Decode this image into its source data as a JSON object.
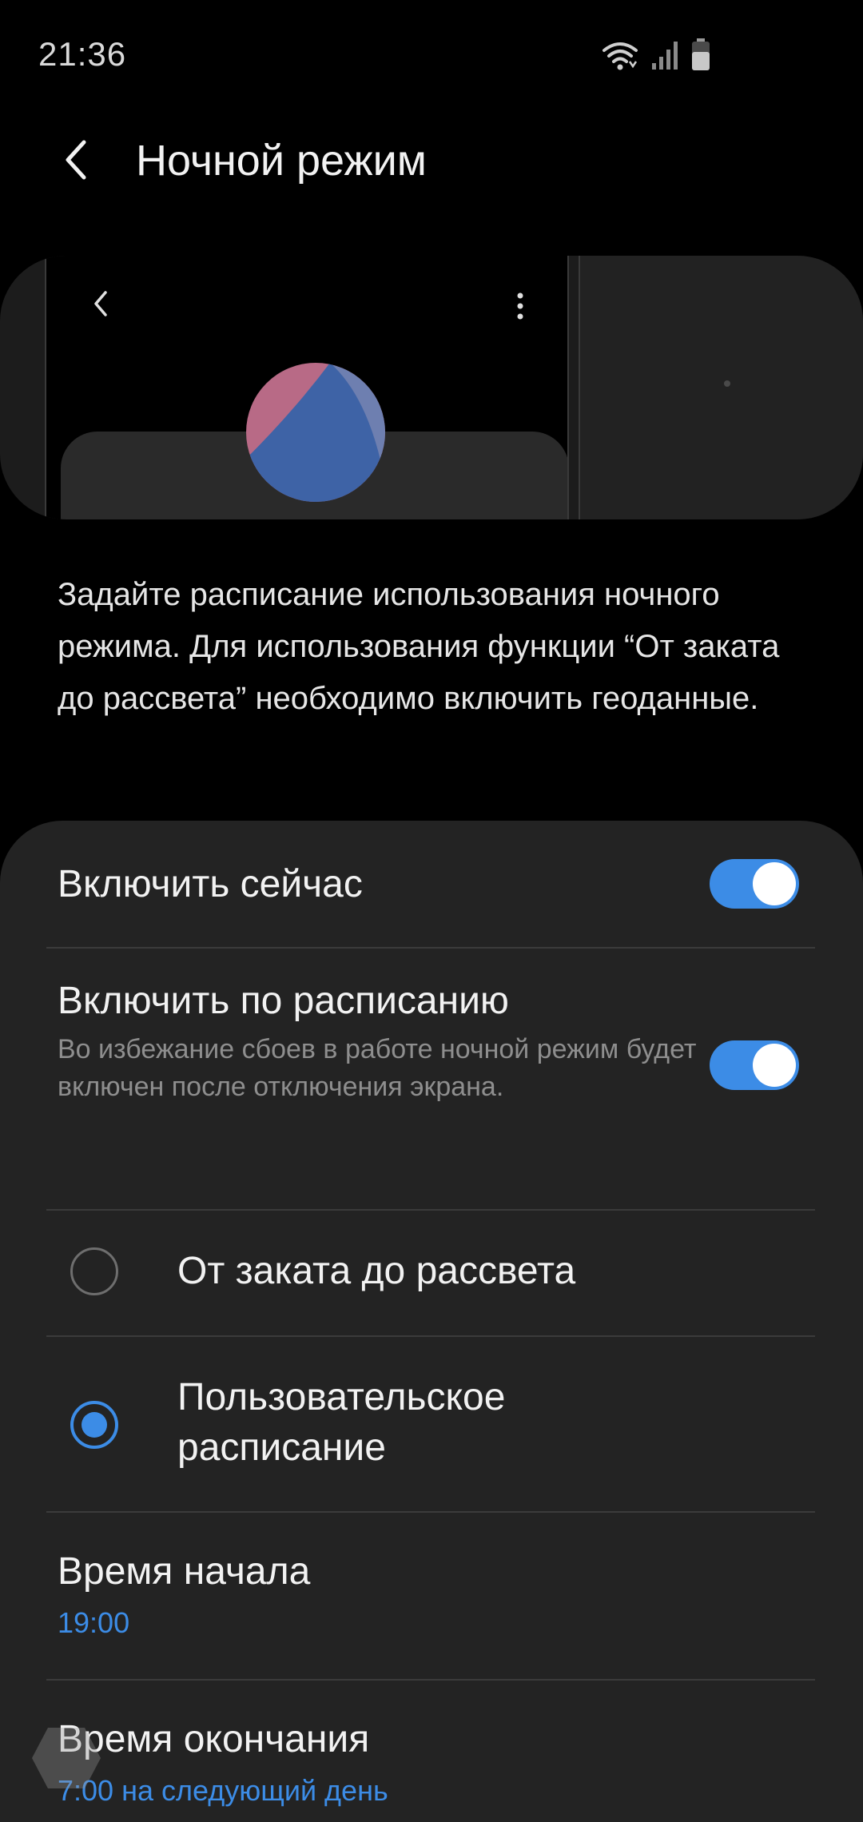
{
  "status_bar": {
    "time": "21:36",
    "icons": [
      "wifi-icon",
      "signal-icon",
      "battery-icon"
    ]
  },
  "header": {
    "title": "Ночной режим"
  },
  "description": "Задайте расписание использования ночного режима. Для использования функции “От заката до рассвета” необходимо включить геоданные.",
  "settings": {
    "turn_on_now": {
      "label": "Включить сейчас",
      "enabled": true
    },
    "scheduled": {
      "label": "Включить по расписанию",
      "subtitle": "Во избежание сбоев в работе ночной режим будет включен после отключения экрана.",
      "enabled": true
    },
    "options": [
      {
        "label": "От заката до рассвета",
        "selected": false
      },
      {
        "label": "Пользовательское расписание",
        "selected": true
      }
    ],
    "start_time": {
      "label": "Время начала",
      "value": "19:00"
    },
    "end_time": {
      "label": "Время окончания",
      "value": "7:00 на следующий день"
    }
  },
  "colors": {
    "accent": "#3c8ce6",
    "background": "#000000",
    "card": "#232323",
    "secondary_text": "#8e8e8e"
  }
}
